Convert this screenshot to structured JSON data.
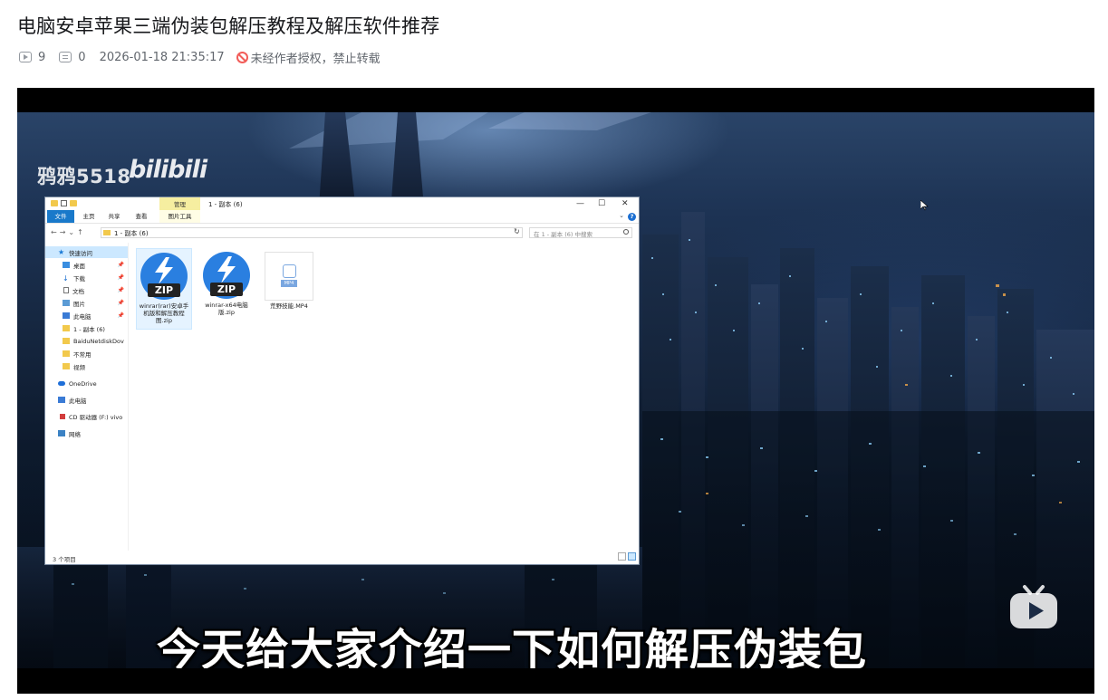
{
  "page": {
    "title": "电脑安卓苹果三端伪装包解压教程及解压软件推荐",
    "meta": {
      "views": "9",
      "comments": "0",
      "date": "2026-01-18 21:35:17",
      "copyright": "未经作者授权，禁止转载"
    }
  },
  "video": {
    "watermark_user": "鸦鸦5518",
    "watermark_logo": "bilibili",
    "subtitle": "今天给大家介绍一下如何解压伪装包",
    "colors": {
      "accent": "#00aeec",
      "danger": "#f25d59"
    }
  },
  "explorer": {
    "manage_label": "管理",
    "window_title": "1 - 副本 (6)",
    "controls": {
      "minimize": "—",
      "maximize": "☐",
      "close": "✕"
    },
    "ribbon_tabs": [
      "文件",
      "主页",
      "共享",
      "查看",
      "图片工具"
    ],
    "address": "1 - 副本 (6)",
    "search_placeholder": "在 1 - 副本 (6) 中搜索",
    "nav_tree": [
      {
        "label": "快速访问",
        "icon": "star-icon"
      },
      {
        "label": "桌面",
        "icon": "desktop-icon"
      },
      {
        "label": "下载",
        "icon": "download-icon"
      },
      {
        "label": "文档",
        "icon": "document-icon"
      },
      {
        "label": "图片",
        "icon": "picture-icon"
      },
      {
        "label": "此电脑",
        "icon": "computer-icon"
      },
      {
        "label": "1 - 副本 (6)",
        "icon": "folder-icon"
      },
      {
        "label": "BaiduNetdiskDov",
        "icon": "folder-icon"
      },
      {
        "label": "不常用",
        "icon": "folder-icon"
      },
      {
        "label": "视频",
        "icon": "folder-icon"
      },
      {
        "label": "OneDrive",
        "icon": "cloud-icon"
      },
      {
        "label": "此电脑",
        "icon": "computer-icon"
      },
      {
        "label": "CD 驱动器 (F:) vivo",
        "icon": "cd-icon"
      },
      {
        "label": "网络",
        "icon": "network-icon"
      }
    ],
    "files": [
      {
        "name": "winrar(rar)安卓手机版和解压教程图.zip",
        "badge": "ZIP",
        "icon": "zip-icon"
      },
      {
        "name": "winrar-x64电脑版.zip",
        "badge": "ZIP",
        "icon": "zip-icon"
      },
      {
        "name": "荒野技能.MP4",
        "badge": "MP4",
        "icon": "mp4-icon"
      }
    ],
    "status": "3 个项目"
  }
}
